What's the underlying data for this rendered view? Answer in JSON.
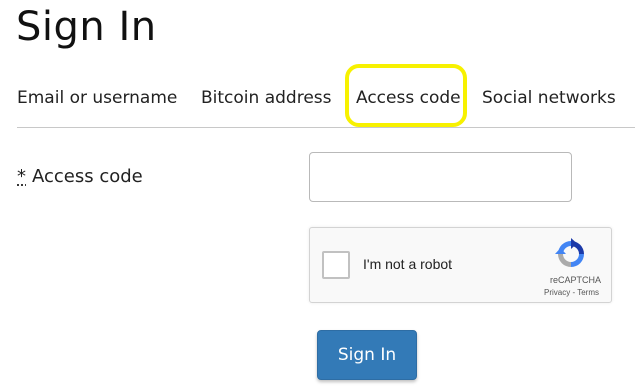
{
  "page": {
    "title": "Sign In"
  },
  "tabs": [
    {
      "label": "Email or username"
    },
    {
      "label": "Bitcoin address"
    },
    {
      "label": "Access code",
      "active": true
    },
    {
      "label": "Social networks"
    }
  ],
  "form": {
    "required_mark": "*",
    "access_code_label": "Access code",
    "access_code_value": "",
    "submit_label": "Sign In"
  },
  "recaptcha": {
    "label": "I'm not a robot",
    "brand": "reCAPTCHA",
    "privacy": "Privacy",
    "separator": " - ",
    "terms": "Terms"
  },
  "colors": {
    "highlight": "#f7f100",
    "button": "#337ab7",
    "tab_border": "#c8c8c8"
  },
  "icons": {
    "recaptcha_logo": "recaptcha-logo-icon"
  }
}
